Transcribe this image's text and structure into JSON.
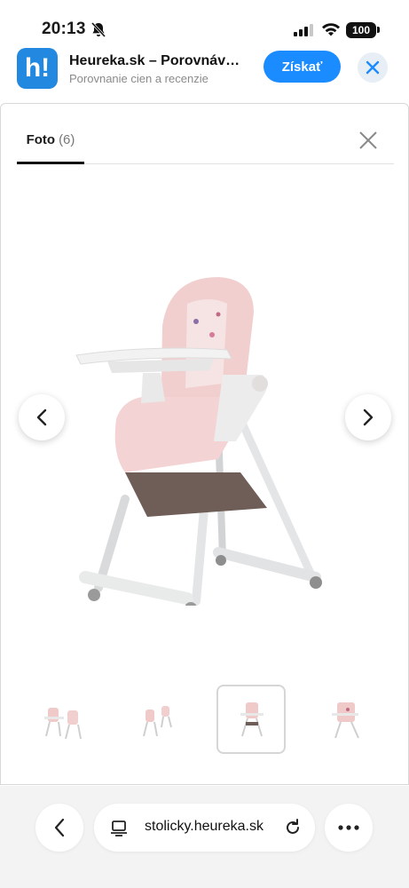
{
  "status": {
    "time": "20:13",
    "battery": "100",
    "icons": [
      "bell-slash-icon",
      "signal-icon",
      "wifi-icon",
      "battery-icon"
    ]
  },
  "banner": {
    "logo_text": "h!",
    "title": "Heureka.sk – Porovnáv…",
    "subtitle": "Porovnanie cien a recenzie",
    "get_label": "Získať",
    "accent": "#1a8cff",
    "logo_color": "#2288e0"
  },
  "gallery": {
    "tab_label": "Foto",
    "tab_count": "(6)",
    "thumbnails": [
      {
        "label": "thumb-1"
      },
      {
        "label": "thumb-2"
      },
      {
        "label": "thumb-3"
      },
      {
        "label": "thumb-4"
      }
    ],
    "selected_index": 2
  },
  "browser": {
    "url": "stolicky.heureka.sk"
  }
}
